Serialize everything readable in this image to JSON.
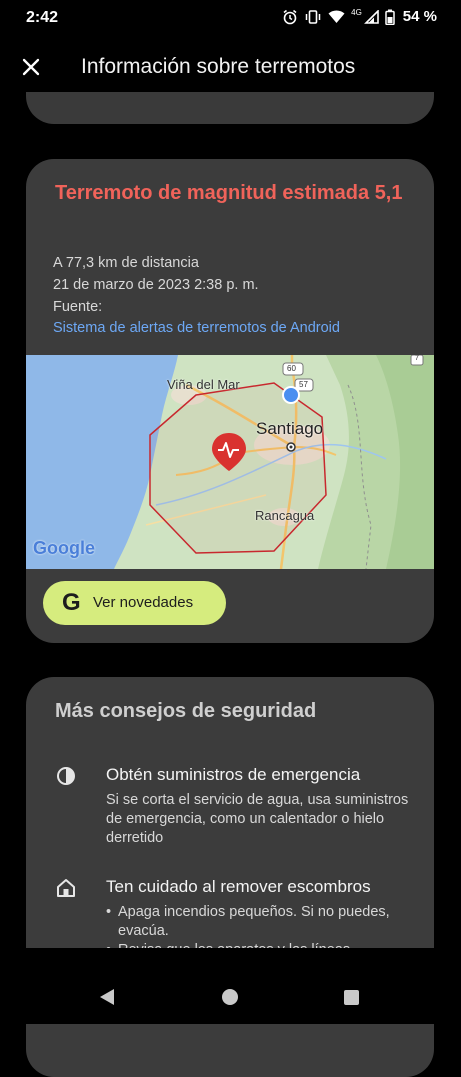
{
  "status_bar": {
    "time": "2:42",
    "network_label": "4G",
    "battery": "54 %"
  },
  "app_bar": {
    "title": "Información sobre terremotos"
  },
  "alert": {
    "title": "Terremoto de magnitud estimada 5,1",
    "distance": "A 77,3 km de distancia",
    "datetime": "21 de marzo de 2023 2:38 p. m.",
    "source_label": "Fuente:",
    "source_link": "Sistema de alertas de terremotos de Android",
    "title_color": "#f0635a",
    "link_color": "#6da8f5"
  },
  "map": {
    "places": [
      "Viña del Mar",
      "Santiago",
      "Rancagua"
    ],
    "route_shields": [
      "60",
      "57",
      "7"
    ],
    "attribution": "Google"
  },
  "news_button": {
    "icon": "G",
    "label": "Ver novedades",
    "color": "#d6ec7e"
  },
  "tips": {
    "title": "Más consejos de seguridad",
    "items": [
      {
        "icon": "contrast-icon",
        "heading": "Obtén suministros de emergencia",
        "body": "Si se corta el servicio de agua, usa suministros de emergencia, como un calentador o hielo derretido"
      },
      {
        "icon": "house-icon",
        "heading": "Ten cuidado al remover escombros",
        "bullets": [
          "Apaga incendios pequeños. Si no puedes, evacúa.",
          "Revisa que los aparatos y las líneas"
        ]
      }
    ]
  }
}
